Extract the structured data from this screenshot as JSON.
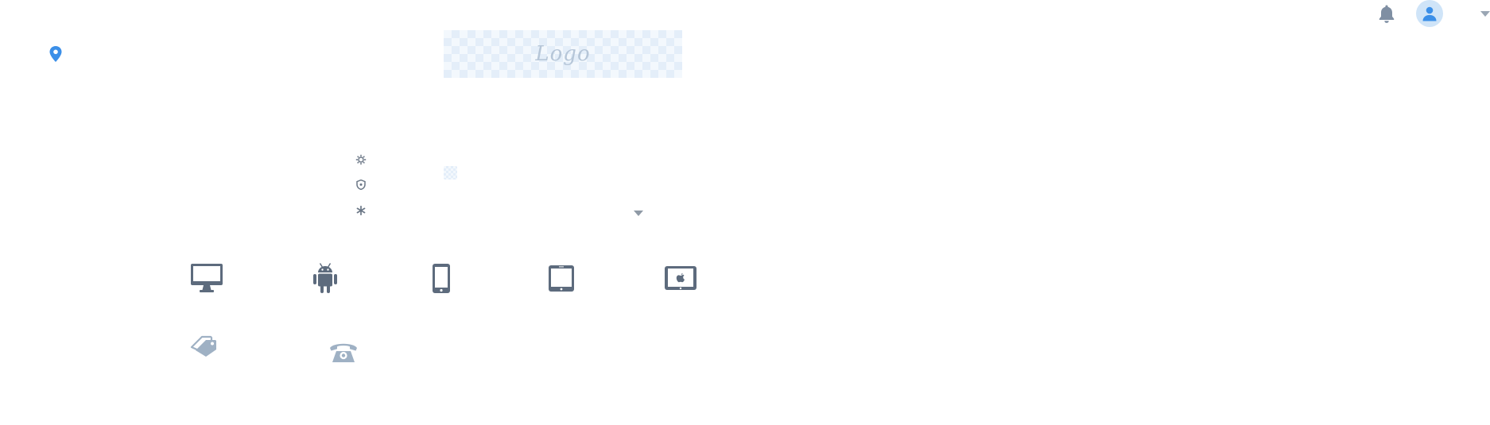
{
  "header": {
    "logo_text": "Logo",
    "icons": {
      "location": "map-pin-icon",
      "notifications": "bell-icon",
      "avatar": "user-icon",
      "account_menu": "caret-down-icon"
    },
    "accent_color": "#3b8fe8",
    "muted_color": "#8fa3b8"
  },
  "side_icons": [
    "gear-icon",
    "shield-icon",
    "asterisk-icon"
  ],
  "device_icons": [
    "desktop-icon",
    "android-icon",
    "phone-icon",
    "tablet-icon",
    "ipad-apple-icon"
  ],
  "extra_icons": [
    "tags-icon",
    "telephone-icon"
  ]
}
